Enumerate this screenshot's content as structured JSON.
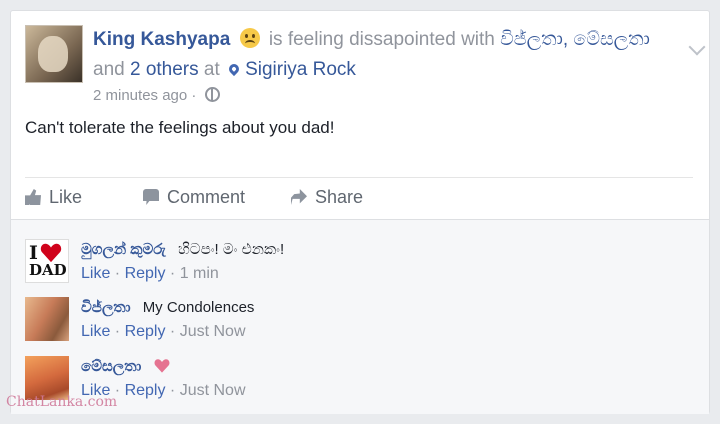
{
  "post": {
    "author": "King Kashyapa",
    "feeling_text": "is feeling dissapointed with",
    "tagged": "විජ්ලතා, මේසලතා",
    "and_text": "and",
    "others": "2 others",
    "at_text": "at",
    "location": "Sigiriya Rock",
    "timestamp": "2 minutes ago",
    "separator": "·",
    "body": "Can't tolerate the feelings about you dad!"
  },
  "actions": {
    "like": "Like",
    "comment": "Comment",
    "share": "Share"
  },
  "comments": [
    {
      "author": "මුගලන් කුමරු",
      "text": "හිටපං! මං එනකං!",
      "like": "Like",
      "reply": "Reply",
      "time": "1 min",
      "avatar_text_top": "I",
      "avatar_text_bottom": "DAD"
    },
    {
      "author": "විජ්ලතා",
      "text": "My Condolences",
      "like": "Like",
      "reply": "Reply",
      "time": "Just Now"
    },
    {
      "author": "මේසලතා",
      "text": "",
      "like": "Like",
      "reply": "Reply",
      "time": "Just Now"
    }
  ],
  "watermark": "ChatLanka.com",
  "colors": {
    "link": "#365899",
    "meta": "#90949c",
    "heart": "#e0245e"
  }
}
